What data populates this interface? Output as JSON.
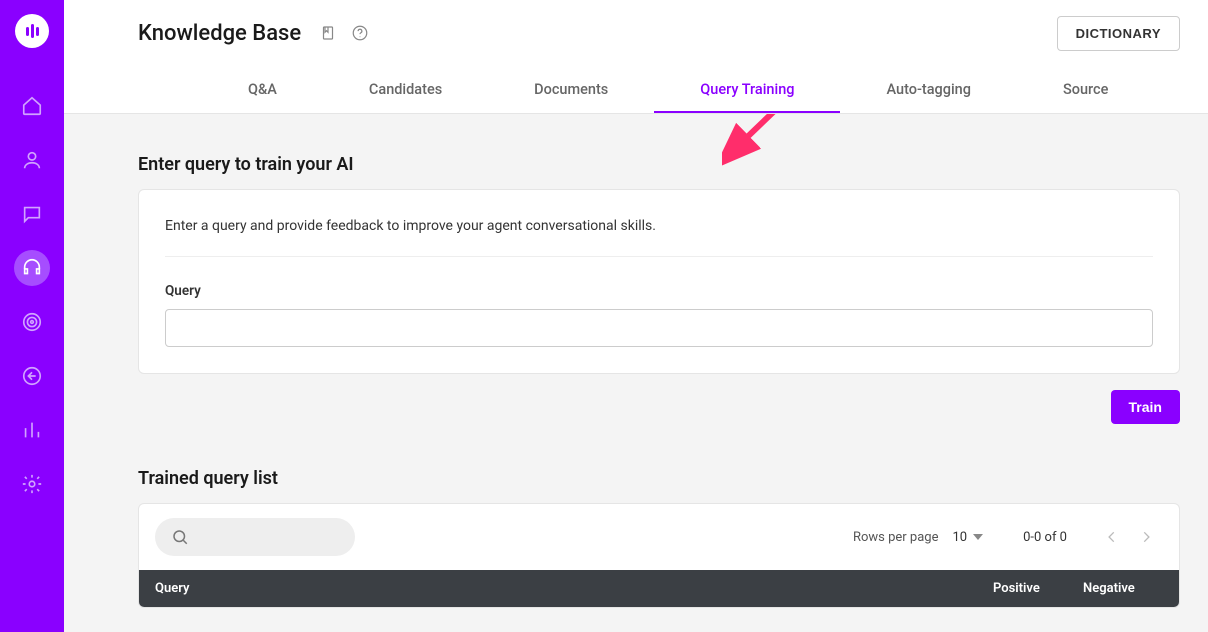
{
  "header": {
    "title": "Knowledge Base",
    "dictionary_button": "DICTIONARY"
  },
  "tabs": {
    "qa": "Q&A",
    "candidates": "Candidates",
    "documents": "Documents",
    "query_training": "Query Training",
    "auto_tagging": "Auto-tagging",
    "source": "Source"
  },
  "query_section": {
    "title": "Enter query to train your AI",
    "description": "Enter a query and provide feedback to improve your agent conversational skills.",
    "input_label": "Query",
    "input_value": "",
    "train_button": "Train"
  },
  "list_section": {
    "title": "Trained query list",
    "rows_per_page_label": "Rows per page",
    "rows_per_page_value": "10",
    "range": "0-0 of 0",
    "columns": {
      "query": "Query",
      "positive": "Positive",
      "negative": "Negative"
    }
  },
  "colors": {
    "brand": "#8A00FF",
    "annotation": "#FF2D6B"
  }
}
